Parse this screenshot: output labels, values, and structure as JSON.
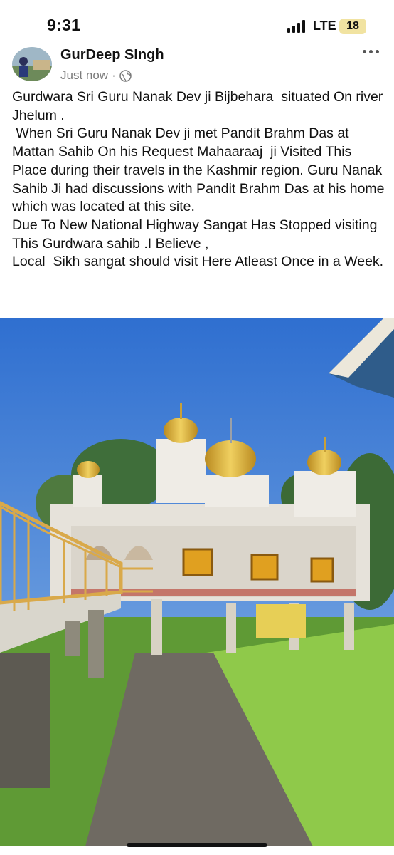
{
  "status_bar": {
    "time": "9:31",
    "network": "LTE",
    "battery": "18"
  },
  "post": {
    "author": "GurDeep SIngh",
    "timestamp": "Just now",
    "separator": "·",
    "privacy_icon": "globe-icon",
    "more_icon": "more-horizontal-icon",
    "text": "Gurdwara Sri Guru Nanak Dev ji Bijbehara  situated On river Jhelum .\n When Sri Guru Nanak Dev ji met Pandit Brahm Das at Mattan Sahib On his Request Mahaaraaj  ji Visited This Place during their travels in the Kashmir region. Guru Nanak  Sahib Ji had discussions with Pandit Brahm Das at his home which was located at this site.\nDue To New National Highway Sangat Has Stopped visiting This Gurdwara sahib .I Believe ,\nLocal  Sikh sangat should visit Here Atleast Once in a Week."
  },
  "colors": {
    "sky": "#3f7fd8",
    "dome_gold": "#d9b13a",
    "grass": "#6b9a3a",
    "railing": "#d9a94a"
  }
}
